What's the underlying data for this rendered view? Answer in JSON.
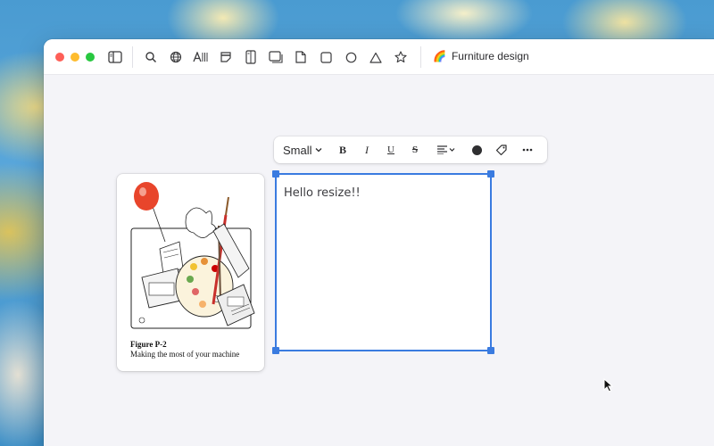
{
  "window": {
    "document_title": "Furniture design",
    "document_emoji": "🌈"
  },
  "toolbar": {
    "icons": [
      "sidebar-toggle-icon",
      "search-icon",
      "globe-icon",
      "text-tool-icon",
      "sticky-note-icon",
      "column-icon",
      "window-icon",
      "page-icon",
      "square-icon",
      "circle-icon",
      "triangle-icon",
      "star-icon"
    ]
  },
  "format_toolbar": {
    "size_label": "Small",
    "bold": "B",
    "italic": "I",
    "underline": "U",
    "strikethrough": "S",
    "color": "#2f2f31"
  },
  "card": {
    "figure_label": "Figure P-2",
    "caption": "Making the most of your machine"
  },
  "textbox": {
    "text": "Hello resize!!",
    "selection_color": "#3a7be0"
  }
}
